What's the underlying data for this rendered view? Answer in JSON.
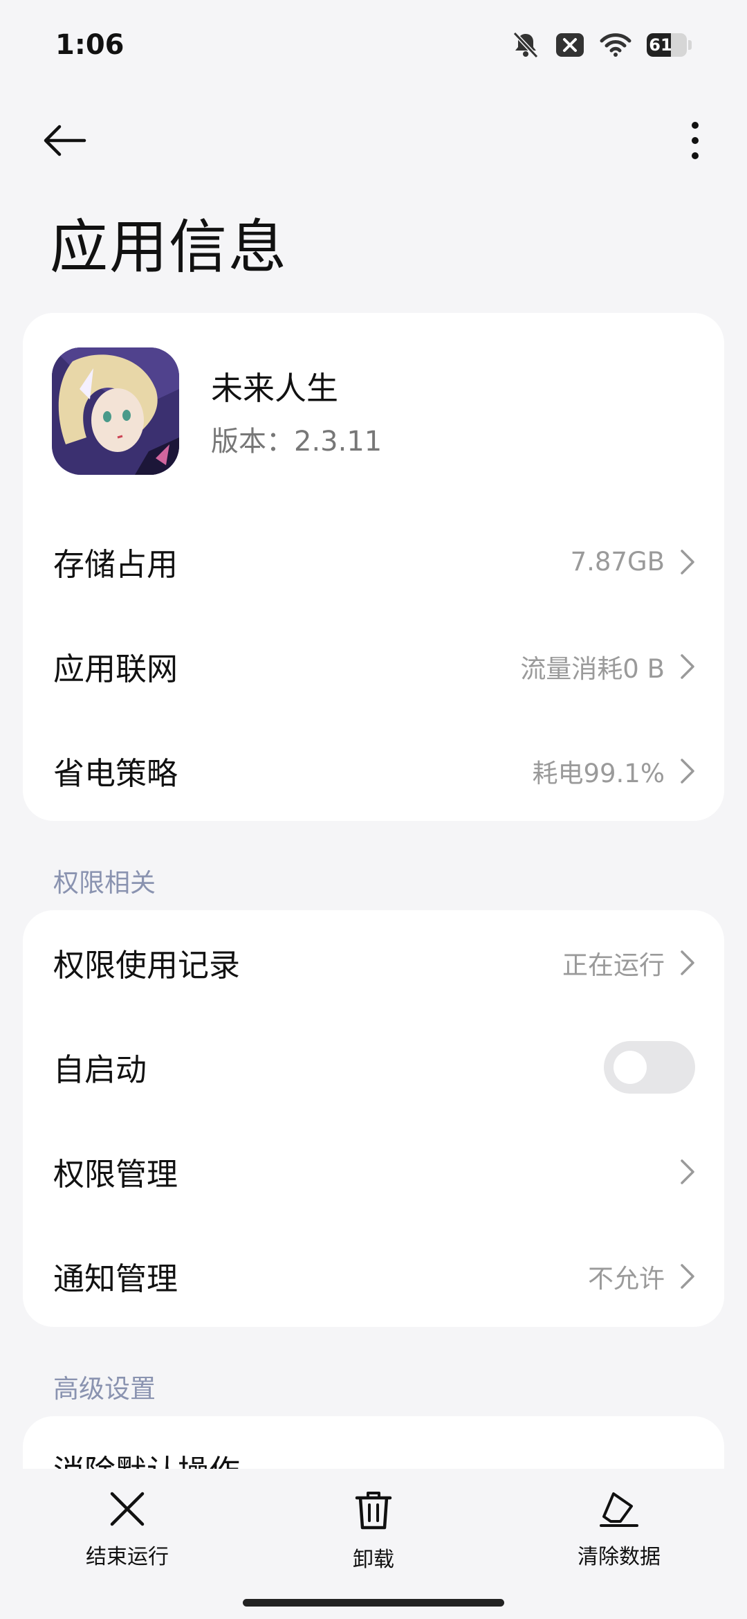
{
  "status_bar": {
    "time": "1:06",
    "icons": [
      "bell-off-icon",
      "close-box-icon",
      "wifi-icon",
      "battery-icon"
    ],
    "battery_level": "61",
    "battery_fraction": 0.61
  },
  "header": {
    "title": "应用信息",
    "back_icon": "arrow-left-icon",
    "menu_icon": "more-vertical-icon"
  },
  "app": {
    "name": "未来人生",
    "version": "版本：2.3.11"
  },
  "info_rows": [
    {
      "label": "存储占用",
      "value": "7.87GB"
    },
    {
      "label": "应用联网",
      "value": "流量消耗0 B"
    },
    {
      "label": "省电策略",
      "value": "耗电99.1%"
    }
  ],
  "permissions_section": {
    "title": "权限相关",
    "rows": [
      {
        "label": "权限使用记录",
        "value": "正在运行"
      },
      {
        "label": "自启动",
        "toggle_on": false
      },
      {
        "label": "权限管理",
        "value": ""
      },
      {
        "label": "通知管理",
        "value": "不允许"
      }
    ]
  },
  "advanced_section": {
    "title": "高级设置",
    "rows": [
      {
        "label": "消除默认操作"
      }
    ]
  },
  "bottom_actions": [
    {
      "label": "结束运行",
      "icon": "close-icon"
    },
    {
      "label": "卸载",
      "icon": "trash-icon"
    },
    {
      "label": "清除数据",
      "icon": "eraser-icon"
    }
  ],
  "colors": {
    "background": "#f5f5f7",
    "card": "#ffffff",
    "section_header": "#8a93b0",
    "secondary_text": "#9a9a9a"
  }
}
